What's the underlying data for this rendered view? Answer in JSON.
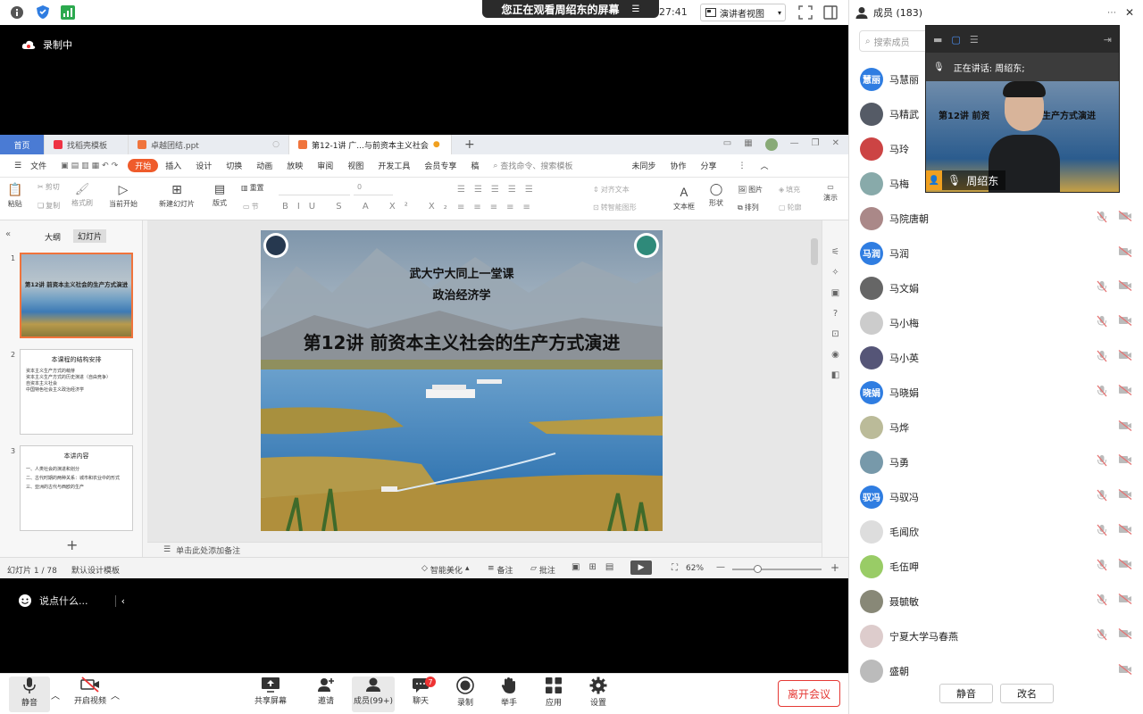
{
  "window": {
    "share_banner": "您正在观看周绍东的屏幕",
    "time_fragment": "27:41",
    "view_mode": "演讲者视图",
    "recording_label": "录制中"
  },
  "wps": {
    "tabs": [
      {
        "label": "首页",
        "kind": "home"
      },
      {
        "label": "找稻壳模板",
        "kind": "doc"
      },
      {
        "label": "卓越团结.ppt",
        "kind": "doc"
      },
      {
        "label": "第12-1讲 广...与前资本主义社会",
        "kind": "active"
      }
    ],
    "menus": [
      "文件",
      "开始",
      "插入",
      "设计",
      "切换",
      "动画",
      "放映",
      "审阅",
      "视图",
      "开发工具",
      "会员专享",
      "稿"
    ],
    "search_hint": "查找命令、搜索模板",
    "right_menus": [
      "未同步",
      "协作",
      "分享"
    ],
    "ribbon": {
      "paste": "粘贴",
      "cut": "剪切",
      "copy": "复制",
      "format_painter": "格式刷",
      "play_from": "当前开始",
      "new_slide": "新建幻灯片",
      "layout": "版式",
      "section": "节",
      "reset": "重置",
      "font_size": "0",
      "text_box": "文本框",
      "shapes": "形状",
      "arrange": "排列",
      "picture": "图片",
      "fill": "填充",
      "outline": "轮廓",
      "align_text": "对齐文本",
      "convert_smartart": "转智能图形",
      "more": "演示"
    },
    "left_tabs": [
      "大纲",
      "幻灯片"
    ],
    "thumbs": [
      {
        "num": "1",
        "title": "第12讲 前资本主义社会的生产方式演进"
      },
      {
        "num": "2",
        "title": "本课程的结构安排",
        "lines": [
          "资本主义生产方式的萌芽",
          "资本主义生产方式的历史演进（自由竞争）",
          "自资本主义社会",
          "中国特色社会主义政治经济学"
        ]
      },
      {
        "num": "3",
        "title": "本讲内容",
        "lines": [
          "一、人类社会的演进和划分",
          "二、古代时期的两种关系：城市和农业中的形式",
          "三、亚洲的古代与西欧的生产"
        ]
      }
    ],
    "slide": {
      "line1": "武大宁大同上一堂课",
      "line2": "政治经济学",
      "title": "第12讲 前资本主义社会的生产方式演进"
    },
    "notes": "单击此处添加备注",
    "status": {
      "slide_count": "幻灯片 1 / 78",
      "template": "默认设计模板",
      "beautify": "智能美化",
      "notes_btn": "备注",
      "comment_btn": "批注",
      "zoom": "62%"
    }
  },
  "chat": {
    "placeholder": "说点什么..."
  },
  "toolbar": {
    "mute": "静音",
    "video": "开启视频",
    "share": "共享屏幕",
    "invite": "邀请",
    "members": "成员(99+)",
    "chat": "聊天",
    "chat_badge": "7",
    "record": "录制",
    "raise_hand": "举手",
    "apps": "应用",
    "settings": "设置",
    "leave": "离开会议"
  },
  "panel": {
    "title": "成员 (183)",
    "search_placeholder": "搜索成员",
    "speaking": "正在讲话: 周绍东;",
    "video_name": "周绍东",
    "video_slide_text": "第12讲 前资",
    "video_slide_text2": "生产方式演进",
    "mute_all": "静音",
    "rename": "改名",
    "members": [
      {
        "name": "马慧丽",
        "avatar_text": "慧丽",
        "color": "#2f7de1"
      },
      {
        "name": "马精武",
        "avatar_text": "",
        "color": "#555b66"
      },
      {
        "name": "马玲",
        "avatar_text": "",
        "color": "#c44"
      },
      {
        "name": "马梅",
        "avatar_text": "",
        "color": "#8aa"
      },
      {
        "name": "马院唐朝",
        "avatar_text": "",
        "color": "#a88"
      },
      {
        "name": "马润",
        "avatar_text": "马润",
        "color": "#2f7de1"
      },
      {
        "name": "马文娟",
        "avatar_text": "",
        "color": "#666"
      },
      {
        "name": "马小梅",
        "avatar_text": "",
        "color": "#ccc"
      },
      {
        "name": "马小英",
        "avatar_text": "",
        "color": "#557"
      },
      {
        "name": "马晓娟",
        "avatar_text": "晓娟",
        "color": "#2f7de1"
      },
      {
        "name": "马烨",
        "avatar_text": "",
        "color": "#bb9"
      },
      {
        "name": "马勇",
        "avatar_text": "",
        "color": "#79a"
      },
      {
        "name": "马驭冯",
        "avatar_text": "驭冯",
        "color": "#2f7de1"
      },
      {
        "name": "毛闻欣",
        "avatar_text": "",
        "color": "#ddd"
      },
      {
        "name": "毛伍呷",
        "avatar_text": "",
        "color": "#9c6"
      },
      {
        "name": "聂毓敏",
        "avatar_text": "",
        "color": "#887"
      },
      {
        "name": "宁夏大学马春燕",
        "avatar_text": "",
        "color": "#dcc"
      },
      {
        "name": "盛朝",
        "avatar_text": "",
        "color": "#bbb"
      }
    ]
  }
}
